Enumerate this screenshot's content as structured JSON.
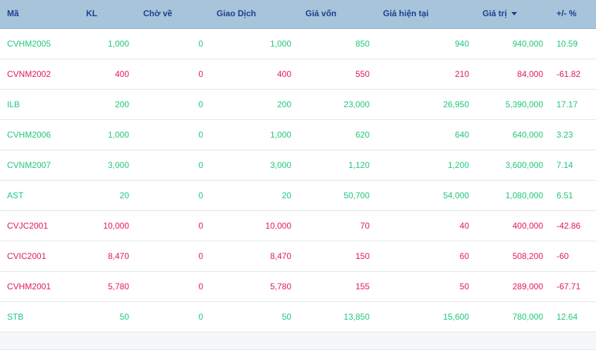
{
  "columns": {
    "ma": "Mã",
    "kl": "KL",
    "cho_ve": "Chờ về",
    "giao_dich": "Giao Dịch",
    "gia_von": "Giá vốn",
    "gia_hien_tai": "Giá hiện tại",
    "gia_tri": "Giá trị",
    "pct": "+/- %"
  },
  "sort": {
    "column": "gia_tri",
    "direction": "desc",
    "icon": "caret-down-icon"
  },
  "colors": {
    "up": "#1ec77a",
    "down": "#e0195b",
    "header_bg": "#a7c4da",
    "header_text": "#1d3f8e"
  },
  "rows": [
    {
      "ma": "CVHM2005",
      "kl": "1,000",
      "cho_ve": "0",
      "giao_dich": "1,000",
      "gia_von": "850",
      "gia_hien_tai": "940",
      "gia_tri": "940,000",
      "pct": "10.59",
      "trend": "up"
    },
    {
      "ma": "CVNM2002",
      "kl": "400",
      "cho_ve": "0",
      "giao_dich": "400",
      "gia_von": "550",
      "gia_hien_tai": "210",
      "gia_tri": "84,000",
      "pct": "-61.82",
      "trend": "down"
    },
    {
      "ma": "ILB",
      "kl": "200",
      "cho_ve": "0",
      "giao_dich": "200",
      "gia_von": "23,000",
      "gia_hien_tai": "26,950",
      "gia_tri": "5,390,000",
      "pct": "17.17",
      "trend": "up"
    },
    {
      "ma": "CVHM2006",
      "kl": "1,000",
      "cho_ve": "0",
      "giao_dich": "1,000",
      "gia_von": "620",
      "gia_hien_tai": "640",
      "gia_tri": "640,000",
      "pct": "3.23",
      "trend": "up"
    },
    {
      "ma": "CVNM2007",
      "kl": "3,000",
      "cho_ve": "0",
      "giao_dich": "3,000",
      "gia_von": "1,120",
      "gia_hien_tai": "1,200",
      "gia_tri": "3,600,000",
      "pct": "7.14",
      "trend": "up"
    },
    {
      "ma": "AST",
      "kl": "20",
      "cho_ve": "0",
      "giao_dich": "20",
      "gia_von": "50,700",
      "gia_hien_tai": "54,000",
      "gia_tri": "1,080,000",
      "pct": "6.51",
      "trend": "up"
    },
    {
      "ma": "CVJC2001",
      "kl": "10,000",
      "cho_ve": "0",
      "giao_dich": "10,000",
      "gia_von": "70",
      "gia_hien_tai": "40",
      "gia_tri": "400,000",
      "pct": "-42.86",
      "trend": "down"
    },
    {
      "ma": "CVIC2001",
      "kl": "8,470",
      "cho_ve": "0",
      "giao_dich": "8,470",
      "gia_von": "150",
      "gia_hien_tai": "60",
      "gia_tri": "508,200",
      "pct": "-60",
      "trend": "down"
    },
    {
      "ma": "CVHM2001",
      "kl": "5,780",
      "cho_ve": "0",
      "giao_dich": "5,780",
      "gia_von": "155",
      "gia_hien_tai": "50",
      "gia_tri": "289,000",
      "pct": "-67.71",
      "trend": "down"
    },
    {
      "ma": "STB",
      "kl": "50",
      "cho_ve": "0",
      "giao_dich": "50",
      "gia_von": "13,850",
      "gia_hien_tai": "15,600",
      "gia_tri": "780,000",
      "pct": "12.64",
      "trend": "up"
    }
  ]
}
